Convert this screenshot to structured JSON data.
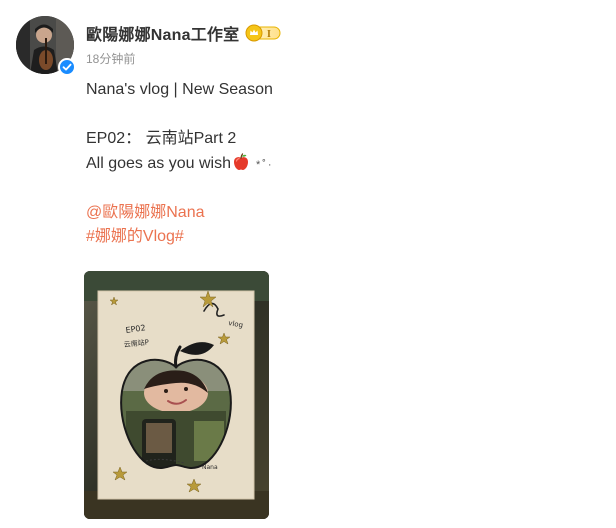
{
  "post": {
    "username": "歐陽娜娜Nana工作室",
    "time": "18分钟前",
    "badge_icon": "vip-level-badge",
    "verified_icon": "verified-check-icon",
    "lines": {
      "title": "Nana's vlog | New Season",
      "episode": "EP02： 云南站Part 2",
      "wish": "All goes as you wish",
      "wish_emoji": "red-apple",
      "sparkle": "*˚·"
    },
    "mention": "@歐陽娜娜Nana",
    "hashtag": "#娜娜的Vlog#",
    "image": {
      "handwriting": [
        "EP02",
        "云南站P",
        "vlog",
        "Nana"
      ]
    },
    "colors": {
      "link": "#eb7350",
      "verified": "#1a8cff",
      "badge": "#f5c518"
    }
  }
}
